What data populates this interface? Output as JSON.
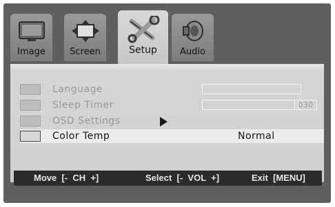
{
  "tabs": [
    {
      "label": "Image",
      "active": false,
      "icon": "tv-icon"
    },
    {
      "label": "Screen",
      "active": false,
      "icon": "screen-move-icon"
    },
    {
      "label": "Setup",
      "active": true,
      "icon": "tools-icon"
    },
    {
      "label": "Audio",
      "active": false,
      "icon": "speaker-icon"
    }
  ],
  "menu": {
    "items": [
      {
        "label": "Language",
        "icon": "language-icon",
        "enabled": false
      },
      {
        "label": "Sleep  Timer",
        "icon": "sleep-timer-icon",
        "enabled": false,
        "value": "030"
      },
      {
        "label": "OSD  Settings",
        "icon": "osd-settings-icon",
        "enabled": false
      },
      {
        "label": "Color  Temp",
        "icon": "color-temp-icon",
        "enabled": true,
        "selected": true,
        "value": "Normal"
      }
    ]
  },
  "footer": {
    "move": "Move  [-  CH  +]",
    "select": "Select  [-  VOL  +]",
    "exit": "Exit  [MENU]"
  },
  "colors": {
    "background": "#5f5f5f",
    "panel": "#d3d3d3",
    "footer": "#2b2b2b"
  }
}
